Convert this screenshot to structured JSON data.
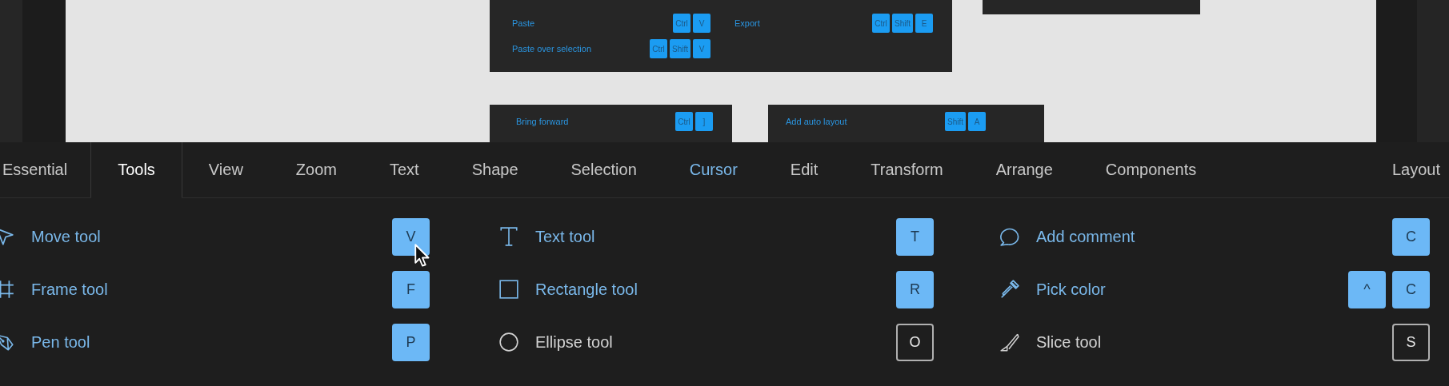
{
  "canvas": {
    "cards": [
      {
        "kind": "shortcuts",
        "columns": [
          [
            {
              "label": "Paste",
              "keys": [
                "Ctrl",
                "V"
              ]
            },
            {
              "label": "Paste over selection",
              "keys": [
                "Ctrl",
                "Shift",
                "V"
              ]
            }
          ],
          [
            {
              "label": "Export",
              "keys": [
                "Ctrl",
                "Shift",
                "E"
              ]
            }
          ]
        ]
      },
      {
        "kind": "blank"
      },
      {
        "kind": "shortcuts",
        "columns": [
          [
            {
              "label": "Bring forward",
              "keys": [
                "Ctrl",
                "]"
              ]
            }
          ]
        ]
      },
      {
        "kind": "shortcuts",
        "columns": [
          [
            {
              "label": "Add auto layout",
              "keys": [
                "Shift",
                "A"
              ]
            }
          ]
        ]
      }
    ]
  },
  "tabs": [
    {
      "label": "Essential",
      "selected": false,
      "highlighted": false
    },
    {
      "label": "Tools",
      "selected": true,
      "highlighted": false
    },
    {
      "label": "View",
      "selected": false,
      "highlighted": false
    },
    {
      "label": "Zoom",
      "selected": false,
      "highlighted": false
    },
    {
      "label": "Text",
      "selected": false,
      "highlighted": false
    },
    {
      "label": "Shape",
      "selected": false,
      "highlighted": false
    },
    {
      "label": "Selection",
      "selected": false,
      "highlighted": false
    },
    {
      "label": "Cursor",
      "selected": false,
      "highlighted": true
    },
    {
      "label": "Edit",
      "selected": false,
      "highlighted": false
    },
    {
      "label": "Transform",
      "selected": false,
      "highlighted": false
    },
    {
      "label": "Arrange",
      "selected": false,
      "highlighted": false
    },
    {
      "label": "Components",
      "selected": false,
      "highlighted": false
    },
    {
      "label": "Layout",
      "selected": false,
      "highlighted": false
    }
  ],
  "columns": [
    [
      {
        "kind": "move",
        "label": "Move tool",
        "keys": [
          "V"
        ],
        "learned": true
      },
      {
        "kind": "frame",
        "label": "Frame tool",
        "keys": [
          "F"
        ],
        "learned": true
      },
      {
        "kind": "pen",
        "label": "Pen tool",
        "keys": [
          "P"
        ],
        "learned": true
      }
    ],
    [
      {
        "kind": "text",
        "label": "Text tool",
        "keys": [
          "T"
        ],
        "learned": true
      },
      {
        "kind": "rectangle",
        "label": "Rectangle tool",
        "keys": [
          "R"
        ],
        "learned": true
      },
      {
        "kind": "ellipse",
        "label": "Ellipse tool",
        "keys": [
          "O"
        ],
        "learned": false
      }
    ],
    [
      {
        "kind": "comment",
        "label": "Add comment",
        "keys": [
          "C"
        ],
        "learned": true
      },
      {
        "kind": "eyedropper",
        "label": "Pick color",
        "keys": [
          "^",
          "C"
        ],
        "learned": true
      },
      {
        "kind": "slice",
        "label": "Slice tool",
        "keys": [
          "S"
        ],
        "learned": false
      }
    ]
  ]
}
